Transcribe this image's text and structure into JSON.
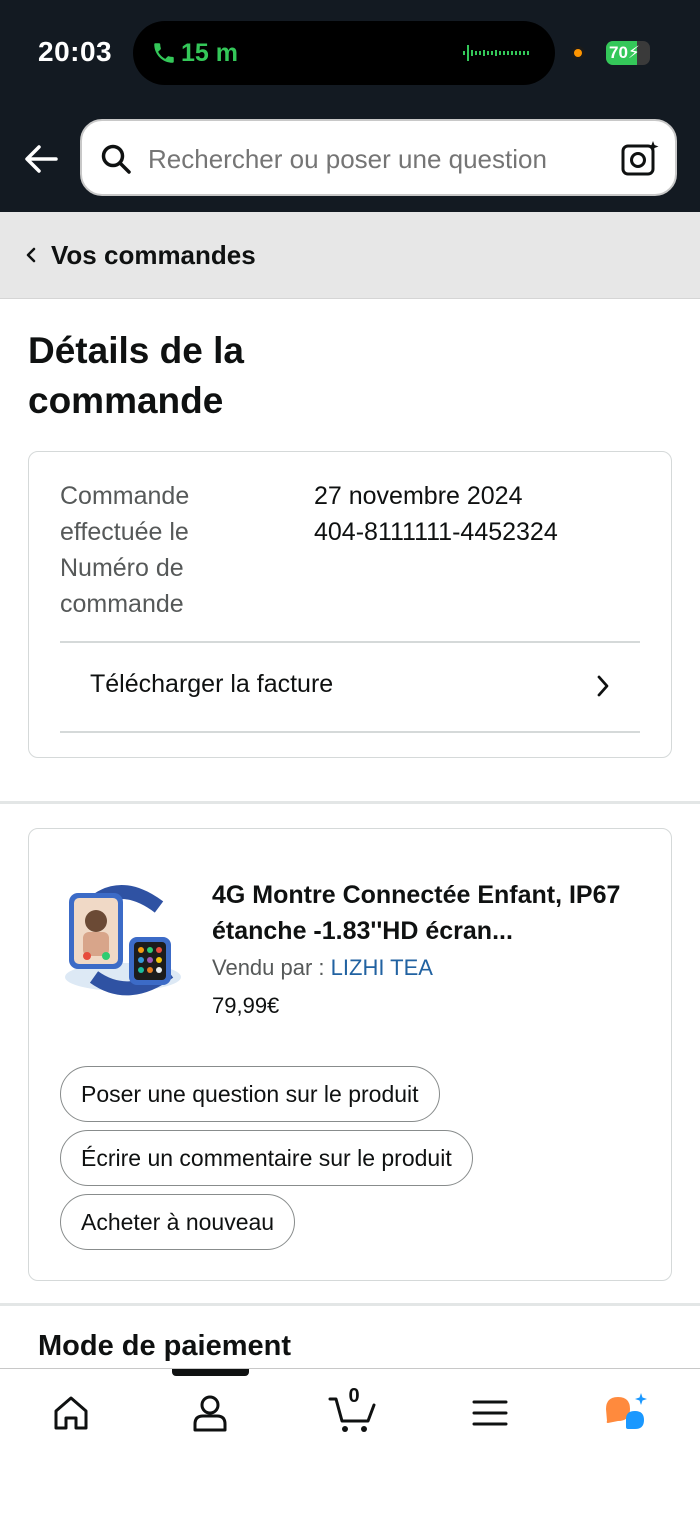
{
  "status_bar": {
    "time": "20:03",
    "call_duration": "15 m",
    "battery_percent": "70",
    "battery_level": 0.7
  },
  "search": {
    "placeholder": "Rechercher ou poser une question"
  },
  "breadcrumb": {
    "label": "Vos commandes"
  },
  "page": {
    "title": "Détails de la commande"
  },
  "order_info": {
    "labels": "Commande effectuée le Numéro de commande",
    "date": "27 novembre 2024",
    "order_number": "404-8111111-4452324",
    "invoice_label": "Télécharger la facture"
  },
  "product": {
    "title": "4G Montre Connectée Enfant, IP67 étanche -1.83''HD écran...",
    "sold_by_prefix": "Vendu par  : ",
    "seller": "LIZHI TEA",
    "price": "79,99€",
    "actions": {
      "ask_question": "Poser une question sur le produit",
      "write_review": "Écrire un commentaire sur le produit",
      "buy_again": "Acheter à nouveau"
    }
  },
  "payment": {
    "section_title": "Mode de paiement"
  },
  "bottom_nav": {
    "cart_count": "0",
    "items": [
      "home-icon",
      "account-icon",
      "cart-icon",
      "menu-icon",
      "rufus-assistant-icon"
    ]
  },
  "colors": {
    "header_bg": "#131a22",
    "call_green": "#34c759",
    "link_blue": "#2162a1",
    "assistant_orange": "#ff8a3d",
    "assistant_blue": "#1a98ff"
  }
}
